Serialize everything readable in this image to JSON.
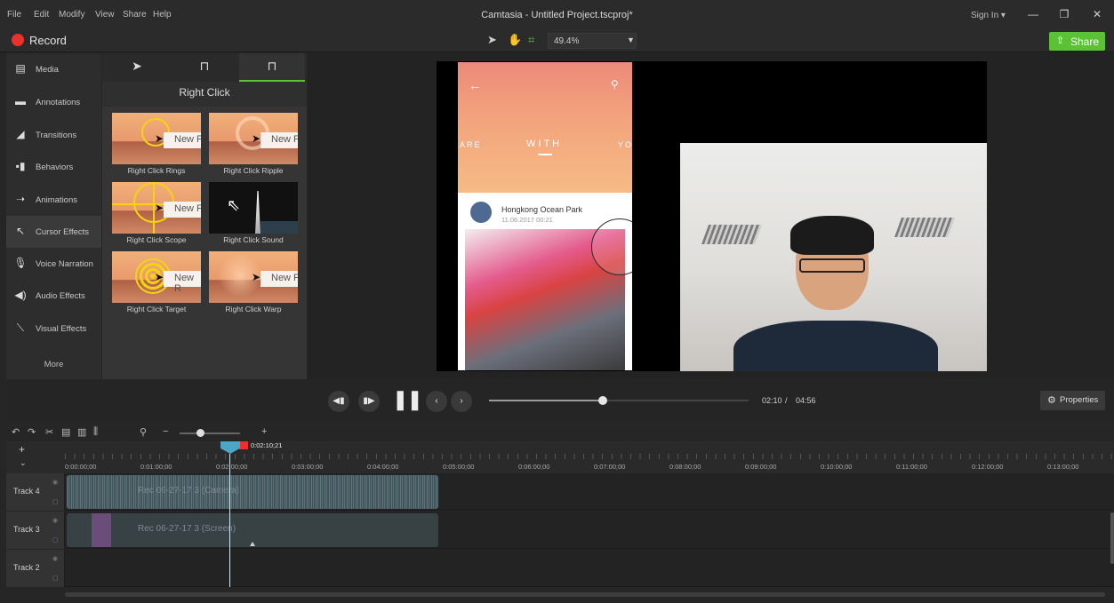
{
  "menubar": {
    "items": [
      "File",
      "Edit",
      "Modify",
      "View",
      "Share",
      "Help"
    ],
    "title": "Camtasia - Untitled Project.tscproj*",
    "sign_in": "Sign In ▾",
    "min": "—",
    "max": "❐",
    "close": "✕"
  },
  "toolbar": {
    "record_label": "Record",
    "zoom": "49.4%",
    "share_label": "Share"
  },
  "sidebar": {
    "items": [
      {
        "label": "Media",
        "icon": "film-icon"
      },
      {
        "label": "Annotations",
        "icon": "annotation-icon"
      },
      {
        "label": "Transitions",
        "icon": "transition-icon"
      },
      {
        "label": "Behaviors",
        "icon": "behavior-icon"
      },
      {
        "label": "Animations",
        "icon": "animation-icon"
      },
      {
        "label": "Cursor Effects",
        "icon": "cursor-effects-icon"
      },
      {
        "label": "Voice Narration",
        "icon": "microphone-icon"
      },
      {
        "label": "Audio Effects",
        "icon": "speaker-icon"
      },
      {
        "label": "Visual Effects",
        "icon": "magic-wand-icon"
      }
    ],
    "more": "More"
  },
  "panel": {
    "title": "Right Click",
    "thumb_text": "New F",
    "thumb_text_alt": "New R",
    "effects": [
      "Right Click Rings",
      "Right Click Ripple",
      "Right Click Scope",
      "Right Click Sound",
      "Right Click Target",
      "Right Click Warp"
    ]
  },
  "phone": {
    "tab_left": "ARE",
    "tab_mid": "WITH",
    "tab_right": "YO",
    "user": "Hongkong Ocean Park",
    "date": "11.06.2017 00:21"
  },
  "playback": {
    "current": "02:10",
    "sep": "/",
    "total": "04:56",
    "progress": 0.44,
    "properties": "Properties"
  },
  "timeline": {
    "playhead_time": "0:02:10;21",
    "ticks": [
      "0:00:00;00",
      "0:01:00;00",
      "0:02:00;00",
      "0:03:00;00",
      "0:04:00;00",
      "0:05:00;00",
      "0:06:00;00",
      "0:07:00;00",
      "0:08:00;00",
      "0:09:00;00",
      "0:10:00;00",
      "0:11:00;00",
      "0:12:00;00",
      "0:13:00;00"
    ],
    "tracks": [
      {
        "label": "Track 4",
        "clip": "Rec 06-27-17 3 (Camera)"
      },
      {
        "label": "Track 3",
        "clip": "Rec 06-27-17 3 (Screen)"
      },
      {
        "label": "Track 2",
        "clip": ""
      }
    ]
  }
}
